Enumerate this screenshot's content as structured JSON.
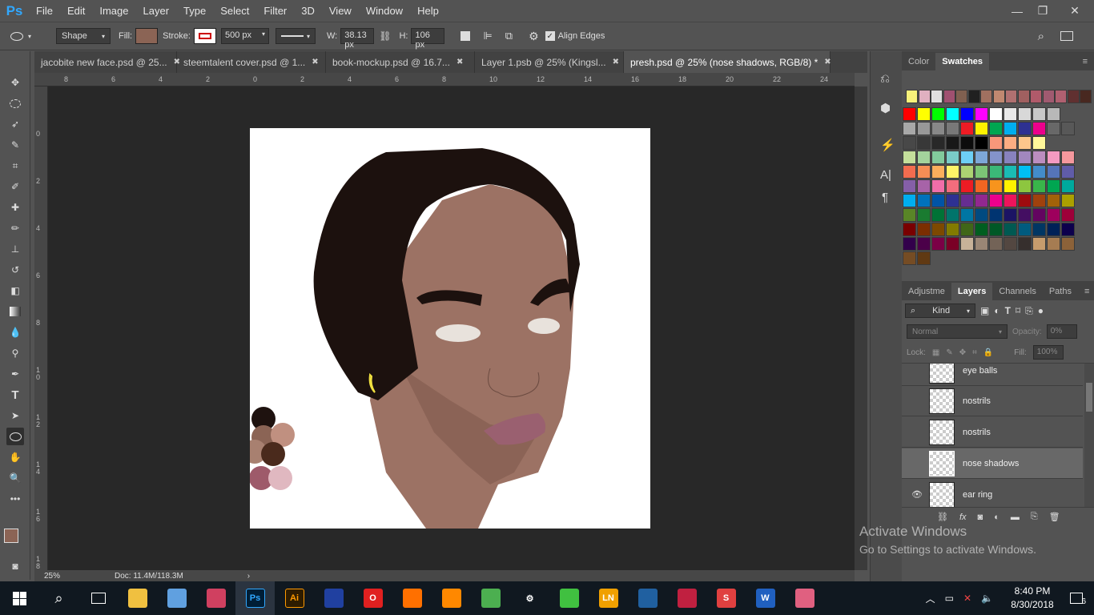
{
  "app": {
    "logo": "Ps"
  },
  "menu": [
    "File",
    "Edit",
    "Image",
    "Layer",
    "Type",
    "Select",
    "Filter",
    "3D",
    "View",
    "Window",
    "Help"
  ],
  "window_controls": {
    "minimize": "—",
    "restore": "❐",
    "close": "✕"
  },
  "options": {
    "mode": "Shape",
    "fill_label": "Fill:",
    "fill_color": "#8b6455",
    "stroke_label": "Stroke:",
    "stroke_width": "500 px",
    "w_label": "W:",
    "w_value": "38.13 px",
    "h_label": "H:",
    "h_value": "106 px",
    "align_edges": "Align Edges"
  },
  "tabs": [
    {
      "label": "jacobite new face.psd @ 25...",
      "active": false
    },
    {
      "label": "steemtalent cover.psd @ 1...",
      "active": false
    },
    {
      "label": "book-mockup.psd @ 16.7...",
      "active": false
    },
    {
      "label": "Layer 1.psb @ 25% (Kingsl...",
      "active": false
    },
    {
      "label": "presh.psd @ 25% (nose shadows, RGB/8) *",
      "active": true
    }
  ],
  "ruler_h": [
    "8",
    "6",
    "4",
    "2",
    "0",
    "2",
    "4",
    "6",
    "8",
    "10",
    "12",
    "14",
    "16",
    "18",
    "20",
    "22",
    "24"
  ],
  "ruler_v": [
    "0",
    "2",
    "4",
    "6",
    "8",
    "1\n0",
    "1\n2",
    "1\n4",
    "1\n6",
    "1\n8"
  ],
  "status": {
    "zoom": "25%",
    "doc": "Doc: 11.4M/118.3M"
  },
  "color_panel": {
    "tab_color": "Color",
    "tab_swatches": "Swatches"
  },
  "swatch_recent": [
    "#f8f27a",
    "#e0b0c0",
    "#e0e0e0",
    "#a05070",
    "#806050",
    "#202020",
    "#a07060",
    "#c08870",
    "#b07070",
    "#a06060",
    "#b05a6a",
    "#a05a70",
    "#b06070",
    "#603030",
    "#482820"
  ],
  "swatches": [
    [
      "#ff0000",
      "#ffff00",
      "#00ff00",
      "#00ffff",
      "#0000ff",
      "#ff00ff",
      "#ffffff",
      "#e8e8e8",
      "#d8d8d8",
      "#c8c8c8",
      "#b8b8b8"
    ],
    [
      "#a8a8a8",
      "#989898",
      "#888888",
      "#787878",
      "#ed1c24",
      "#fff200",
      "#00a651",
      "#00aeef",
      "#2e3192",
      "#ec008c",
      "#686868",
      "#585858"
    ],
    [
      "#484848",
      "#383838",
      "#282828",
      "#181818",
      "#0c0c0c",
      "#000000",
      "#f7977a",
      "#fbad82",
      "#fdc68c",
      "#fff79a"
    ],
    [
      "#c4df9b",
      "#a3d39c",
      "#82ca9c",
      "#7accc8",
      "#6dcff6",
      "#7da7d8",
      "#8493ca",
      "#8882be",
      "#a187be",
      "#bc8dbf",
      "#f49ac1",
      "#f5989d"
    ],
    [
      "#f26c4f",
      "#f68e55",
      "#fbaf5c",
      "#fff467",
      "#acd372",
      "#7cc576",
      "#3bb878",
      "#1abbb4",
      "#00bff3",
      "#438cca",
      "#5574b9",
      "#605ca8"
    ],
    [
      "#855fa8",
      "#a763a8",
      "#f06ea9",
      "#f26d7d",
      "#ed1c24",
      "#f26522",
      "#f7941d",
      "#fff200",
      "#8dc63f",
      "#39b54a",
      "#00a651",
      "#00a99d"
    ],
    [
      "#00aeef",
      "#0072bc",
      "#0054a6",
      "#2e3192",
      "#662d91",
      "#92278f",
      "#ec008c",
      "#ed145b",
      "#9e0b0f",
      "#a0410d",
      "#a36209",
      "#aba000"
    ],
    [
      "#598527",
      "#1a7b30",
      "#007236",
      "#00746b",
      "#0076a3",
      "#004a80",
      "#003471",
      "#1b1464",
      "#440e62",
      "#630460",
      "#9e005d",
      "#9e0039"
    ],
    [
      "#790000",
      "#7b2e00",
      "#7d4900",
      "#827b00",
      "#406618",
      "#005e20",
      "#005826",
      "#005952",
      "#005b7f",
      "#003663",
      "#002157",
      "#0d004c"
    ],
    [
      "#32004b",
      "#4b0049",
      "#7b0046",
      "#7a0026",
      "#c7b299",
      "#998675",
      "#736357",
      "#534741",
      "#362f2d",
      "#c69c6d",
      "#a67c52",
      "#8c6239"
    ],
    [
      "#754c24",
      "#603913"
    ]
  ],
  "layers_panel": {
    "tabs": [
      "Adjustme",
      "Layers",
      "Channels",
      "Paths"
    ],
    "kind": "Kind",
    "blend": "Normal",
    "opacity_label": "Opacity:",
    "opacity": "0%",
    "lock_label": "Lock:",
    "fill_label": "Fill:",
    "fill": "100%",
    "layers": [
      {
        "name": "eye balls",
        "visible": false,
        "selected": false
      },
      {
        "name": "nostrils",
        "visible": false,
        "selected": false
      },
      {
        "name": "nostrils",
        "visible": false,
        "selected": false
      },
      {
        "name": "nose shadows",
        "visible": false,
        "selected": true
      },
      {
        "name": "ear ring",
        "visible": true,
        "selected": false
      }
    ]
  },
  "palette_colors": [
    "#1e120f",
    "#8b6455",
    "#c09080",
    "#a88070",
    "#4a2a1c",
    "#9e5a6a",
    "#e0b8c0"
  ],
  "colors": {
    "hair": "#1c110e",
    "skin": "#9c7264",
    "skin_dark": "#8a6254",
    "lips": "#9a6070",
    "earring": "#f0e040",
    "fg": "#8b6455",
    "bg": "#ffffff"
  },
  "watermark": {
    "line1": "Activate Windows",
    "line2": "Go to Settings to activate Windows."
  },
  "taskbar": {
    "apps": [
      "File Explorer",
      "Notepad",
      "Paint",
      "Photoshop",
      "Illustrator",
      "Media",
      "Opera",
      "Firefox",
      "VLC",
      "Chrome",
      "Settings",
      "Spotify",
      "LN",
      "Outlook",
      "Video",
      "Sway",
      "WPS",
      "Eraser"
    ],
    "time": "8:40 PM",
    "date": "8/30/2018",
    "notif": "6"
  }
}
